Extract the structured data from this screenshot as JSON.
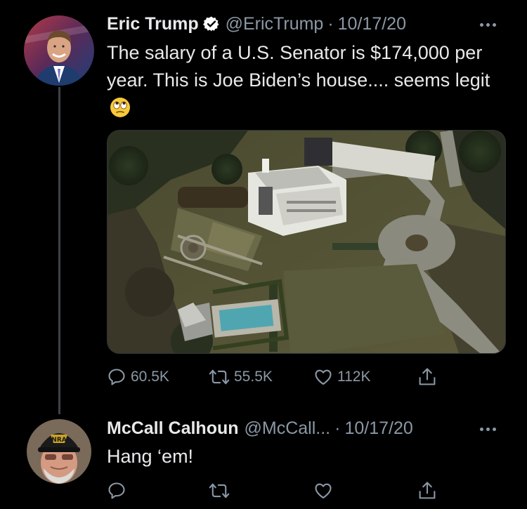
{
  "tweet": {
    "author_name": "Eric Trump",
    "handle": "@EricTrump",
    "separator": "·",
    "date": "10/17/20",
    "text": "The salary of a U.S. Senator is $174,000 per year. This is Joe Biden’s house.... seems legit",
    "emoji": "face-with-rolling-eyes",
    "media": "aerial photo of a large white mansion with lawns, circular driveway and a swimming pool",
    "actions": {
      "replies": "60.5K",
      "retweets": "55.5K",
      "likes": "112K"
    }
  },
  "reply": {
    "author_name": "McCall Calhoun",
    "handle": "@McCall...",
    "separator": "·",
    "date": "10/17/20",
    "text": "Hang ‘em!",
    "avatar_cap_text": "NRA"
  },
  "colors": {
    "background": "#000000",
    "text_primary": "#e7e9ea",
    "text_secondary": "#8b98a5",
    "verified_badge": "#ffffff",
    "thread_line": "#3d4247"
  }
}
